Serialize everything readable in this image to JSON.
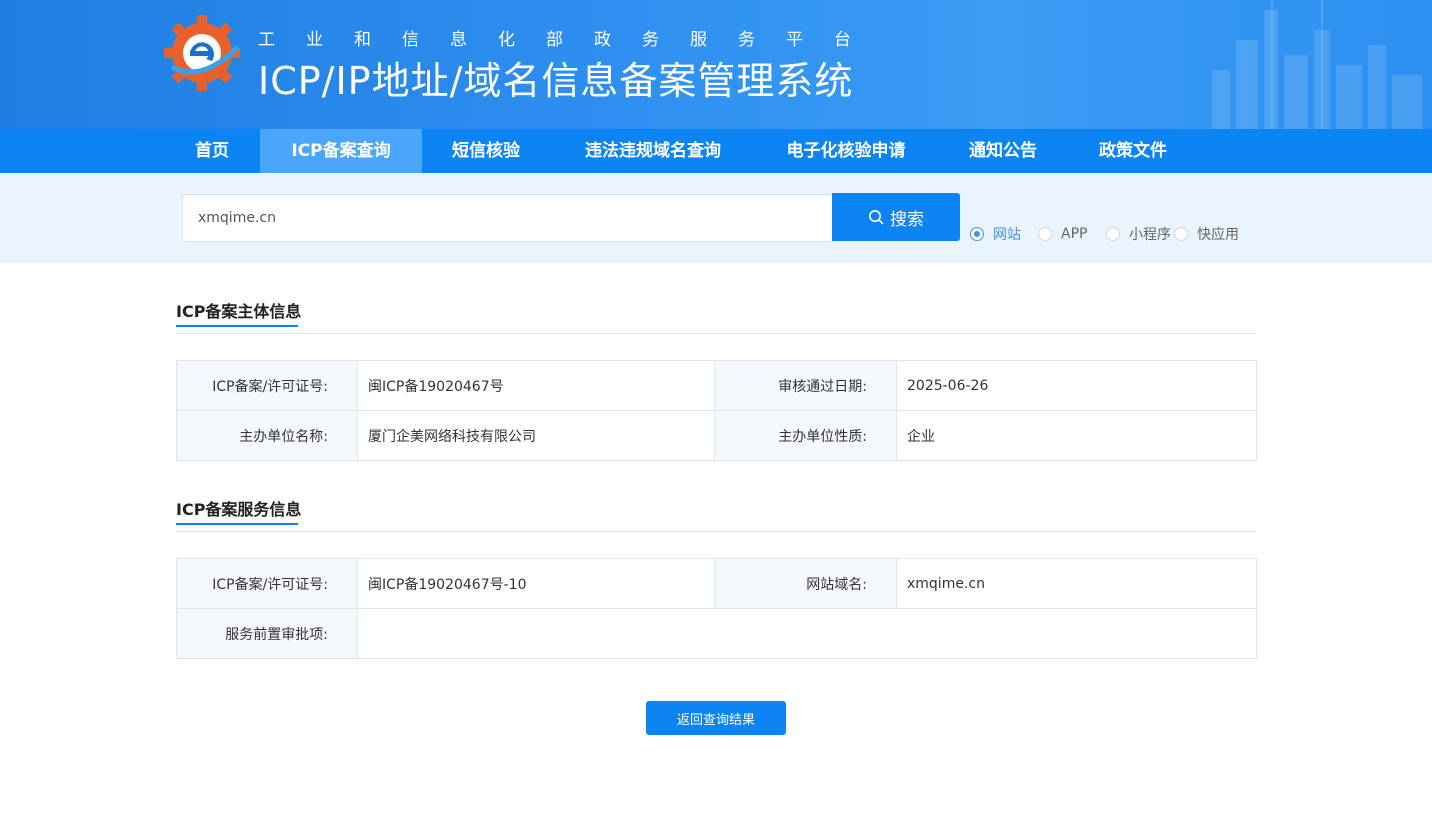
{
  "header": {
    "subtitle": "工业和信息化部政务服务平台",
    "title": "ICP/IP地址/域名信息备案管理系统"
  },
  "nav": {
    "items": [
      {
        "label": "首页"
      },
      {
        "label": "ICP备案查询"
      },
      {
        "label": "短信核验"
      },
      {
        "label": "违法违规域名查询"
      },
      {
        "label": "电子化核验申请"
      },
      {
        "label": "通知公告"
      },
      {
        "label": "政策文件"
      }
    ],
    "active_index": 1
  },
  "search": {
    "value": "xmqime.cn",
    "button_label": "搜索",
    "types": [
      {
        "label": "网站",
        "checked": true
      },
      {
        "label": "APP",
        "checked": false
      },
      {
        "label": "小程序",
        "checked": false
      },
      {
        "label": "快应用",
        "checked": false
      }
    ]
  },
  "subject_info": {
    "title": "ICP备案主体信息",
    "rows": [
      [
        "ICP备案/许可证号:",
        "闽ICP备19020467号",
        "审核通过日期:",
        "2025-06-26"
      ],
      [
        "主办单位名称:",
        "厦门企美网络科技有限公司",
        "主办单位性质:",
        "企业"
      ]
    ]
  },
  "service_info": {
    "title": "ICP备案服务信息",
    "rows": [
      [
        "ICP备案/许可证号:",
        "闽ICP备19020467号-10",
        "网站域名:",
        "xmqime.cn"
      ],
      [
        "服务前置审批项:",
        ""
      ]
    ]
  },
  "actions": {
    "back_label": "返回查询结果"
  },
  "colors": {
    "primary": "#0d84f4",
    "nav_active": "#4aa6f8",
    "search_bg": "#eaf4fe",
    "radio_checked": "#3e92e8"
  }
}
